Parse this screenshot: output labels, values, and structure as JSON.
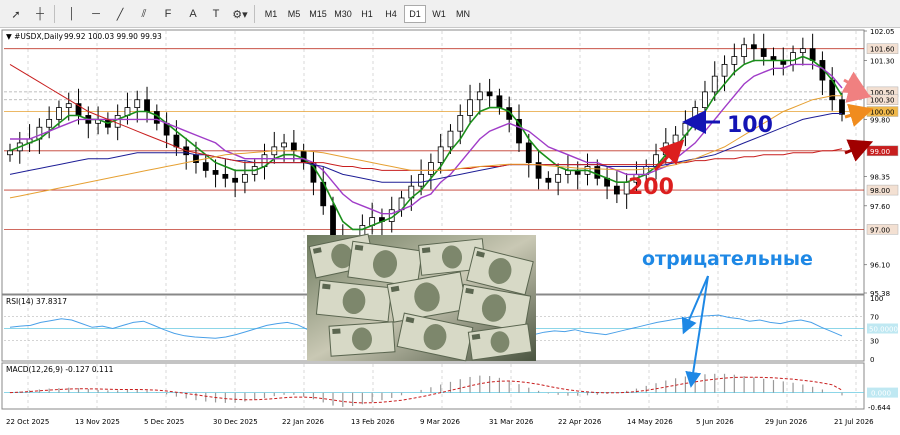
{
  "toolbar": {
    "tools": [
      "cursor-icon",
      "crosshair-icon",
      "vertical-line-icon",
      "horizontal-line-icon",
      "trendline-icon",
      "equidistant-channel-icon",
      "fibonacci-icon",
      "text-label-icon",
      "arrow-label-icon",
      "shapes-dropdown-icon"
    ],
    "timeframes": [
      "M1",
      "M5",
      "M15",
      "M30",
      "H1",
      "H4",
      "D1",
      "W1",
      "MN"
    ],
    "active_timeframe": "D1"
  },
  "chart_header": {
    "symbol": "▼ #USDX,Daily",
    "ohlc": "99.92 100.03 99.90 99.93"
  },
  "rsi_label": "RSI(14) 37.8317",
  "macd_label": "MACD(12,26,9) -0.127 0.111",
  "annotations": {
    "ma100": "100",
    "ma200": "200",
    "negative": "отрицательные"
  },
  "colors": {
    "ema_fast": "#1a8f1a",
    "ema_slow": "#a03cc8",
    "ma100": "#1e1e96",
    "ma200": "#c81e1e",
    "ma_long": "#e6a032",
    "level_red": "#c0392b",
    "level_gray": "#aaaaaa",
    "rsi": "#4aa0e8",
    "price_tag_bg": "#f3e0d2"
  },
  "chart_data": [
    {
      "type": "candlestick",
      "symbol": "#USDX",
      "timeframe": "Daily",
      "ylim": [
        95.38,
        102.05
      ],
      "y_ticks": [
        102.05,
        101.3,
        99.8,
        98.35,
        97.6,
        96.1,
        95.38
      ],
      "x_tick_labels": [
        "22 Oct 2025",
        "13 Nov 2025",
        "5 Dec 2025",
        "30 Dec 2025",
        "22 Jan 2026",
        "13 Feb 2026",
        "9 Mar 2026",
        "31 Mar 2026",
        "22 Apr 2026",
        "14 May 2026",
        "5 Jun 2026",
        "29 Jun 2026",
        "21 Jul 2026"
      ],
      "price_levels": [
        {
          "value": 101.6,
          "label": "101.60",
          "style": "solid",
          "color": "#c0392b"
        },
        {
          "value": 100.5,
          "label": "100.50",
          "style": "dashed",
          "color": "#aaaaaa"
        },
        {
          "value": 100.3,
          "label": "100.30",
          "style": "dashed",
          "color": "#aaaaaa"
        },
        {
          "value": 100.0,
          "label": "100.00",
          "style": "solid",
          "color": "#e6a032"
        },
        {
          "value": 99.0,
          "label": "99.00",
          "style": "solid",
          "color": "#c0392b"
        },
        {
          "value": 98.0,
          "label": "98.00",
          "style": "solid",
          "color": "#c0392b"
        },
        {
          "value": 97.0,
          "label": "97.00",
          "style": "solid",
          "color": "#c0392b"
        }
      ],
      "close": [
        99.0,
        99.2,
        99.3,
        99.6,
        99.8,
        100.1,
        100.2,
        99.9,
        99.7,
        99.8,
        99.6,
        99.9,
        100.1,
        100.3,
        100.0,
        99.7,
        99.4,
        99.1,
        98.9,
        98.7,
        98.5,
        98.4,
        98.3,
        98.2,
        98.4,
        98.6,
        98.9,
        99.1,
        99.2,
        99.0,
        98.7,
        98.2,
        97.6,
        96.8,
        96.2,
        96.6,
        97.1,
        97.3,
        97.2,
        97.5,
        97.8,
        98.1,
        98.4,
        98.7,
        99.1,
        99.5,
        99.9,
        100.3,
        100.5,
        100.4,
        100.1,
        99.8,
        99.2,
        98.7,
        98.3,
        98.2,
        98.4,
        98.5,
        98.4,
        98.6,
        98.3,
        98.1,
        97.9,
        98.2,
        98.4,
        98.6,
        98.9,
        99.2,
        99.4,
        99.7,
        100.1,
        100.5,
        100.9,
        101.2,
        101.4,
        101.7,
        101.6,
        101.4,
        101.3,
        101.2,
        101.5,
        101.6,
        101.3,
        100.8,
        100.3,
        99.93
      ],
      "series": [
        {
          "name": "EMA fast (green)",
          "values": [
            99.0,
            99.1,
            99.2,
            99.3,
            99.5,
            99.7,
            99.9,
            99.9,
            99.8,
            99.8,
            99.7,
            99.8,
            99.9,
            100.0,
            100.0,
            99.9,
            99.7,
            99.5,
            99.3,
            99.1,
            98.9,
            98.7,
            98.6,
            98.5,
            98.5,
            98.5,
            98.6,
            98.8,
            98.9,
            98.9,
            98.8,
            98.6,
            98.2,
            97.7,
            97.2,
            97.0,
            97.0,
            97.1,
            97.2,
            97.3,
            97.5,
            97.8,
            98.0,
            98.3,
            98.6,
            99.0,
            99.3,
            99.7,
            100.0,
            100.1,
            100.1,
            100.0,
            99.7,
            99.3,
            99.0,
            98.8,
            98.6,
            98.5,
            98.5,
            98.5,
            98.4,
            98.3,
            98.2,
            98.2,
            98.3,
            98.4,
            98.6,
            98.9,
            99.1,
            99.4,
            99.7,
            100.0,
            100.4,
            100.7,
            101.0,
            101.2,
            101.3,
            101.3,
            101.3,
            101.3,
            101.3,
            101.4,
            101.3,
            101.1,
            100.8,
            100.4
          ]
        },
        {
          "name": "EMA slow (purple)",
          "values": [
            99.3,
            99.3,
            99.3,
            99.4,
            99.5,
            99.6,
            99.7,
            99.8,
            99.8,
            99.8,
            99.8,
            99.8,
            99.8,
            99.8,
            99.8,
            99.8,
            99.7,
            99.6,
            99.5,
            99.4,
            99.3,
            99.2,
            99.0,
            98.9,
            98.8,
            98.8,
            98.8,
            98.8,
            98.8,
            98.8,
            98.8,
            98.7,
            98.5,
            98.2,
            97.9,
            97.7,
            97.6,
            97.5,
            97.4,
            97.4,
            97.5,
            97.6,
            97.8,
            97.9,
            98.2,
            98.4,
            98.7,
            99.0,
            99.3,
            99.5,
            99.6,
            99.7,
            99.6,
            99.5,
            99.3,
            99.1,
            99.0,
            98.9,
            98.8,
            98.7,
            98.7,
            98.6,
            98.5,
            98.4,
            98.4,
            98.4,
            98.5,
            98.6,
            98.8,
            99.0,
            99.2,
            99.5,
            99.8,
            100.1,
            100.4,
            100.7,
            100.9,
            101.0,
            101.1,
            101.1,
            101.2,
            101.2,
            101.2,
            101.1,
            100.9,
            100.6
          ]
        },
        {
          "name": "MA 100 (navy)",
          "values": [
            98.4,
            98.45,
            98.5,
            98.55,
            98.6,
            98.65,
            98.7,
            98.75,
            98.8,
            98.8,
            98.8,
            98.85,
            98.9,
            98.95,
            98.95,
            98.95,
            98.95,
            98.95,
            98.95,
            98.9,
            98.9,
            98.85,
            98.8,
            98.75,
            98.75,
            98.7,
            98.7,
            98.7,
            98.7,
            98.7,
            98.7,
            98.65,
            98.6,
            98.5,
            98.4,
            98.35,
            98.3,
            98.25,
            98.2,
            98.2,
            98.2,
            98.2,
            98.2,
            98.25,
            98.3,
            98.35,
            98.4,
            98.45,
            98.5,
            98.55,
            98.6,
            98.65,
            98.65,
            98.65,
            98.65,
            98.65,
            98.65,
            98.65,
            98.65,
            98.65,
            98.65,
            98.6,
            98.6,
            98.6,
            98.6,
            98.6,
            98.6,
            98.65,
            98.7,
            98.75,
            98.8,
            98.85,
            98.9,
            99.0,
            99.1,
            99.2,
            99.3,
            99.4,
            99.5,
            99.6,
            99.7,
            99.8,
            99.85,
            99.9,
            99.95,
            99.95
          ]
        },
        {
          "name": "MA 200 (red)",
          "values": [
            101.2,
            101.05,
            100.9,
            100.75,
            100.6,
            100.45,
            100.3,
            100.15,
            100.0,
            99.9,
            99.8,
            99.7,
            99.6,
            99.5,
            99.4,
            99.3,
            99.2,
            99.1,
            99.0,
            98.95,
            98.9,
            98.85,
            98.8,
            98.75,
            98.7,
            98.7,
            98.7,
            98.7,
            98.7,
            98.7,
            98.7,
            98.7,
            98.7,
            98.65,
            98.6,
            98.6,
            98.55,
            98.55,
            98.5,
            98.5,
            98.5,
            98.5,
            98.5,
            98.5,
            98.5,
            98.5,
            98.55,
            98.55,
            98.6,
            98.6,
            98.6,
            98.65,
            98.65,
            98.65,
            98.65,
            98.65,
            98.65,
            98.65,
            98.65,
            98.65,
            98.65,
            98.65,
            98.65,
            98.65,
            98.65,
            98.65,
            98.65,
            98.7,
            98.7,
            98.7,
            98.75,
            98.75,
            98.8,
            98.8,
            98.8,
            98.85,
            98.85,
            98.9,
            98.9,
            98.9,
            98.95,
            98.95,
            98.95,
            99.0,
            99.0,
            99.05
          ]
        },
        {
          "name": "MA long (orange)",
          "values": [
            97.8,
            97.85,
            97.9,
            97.95,
            98.0,
            98.05,
            98.1,
            98.15,
            98.2,
            98.25,
            98.3,
            98.35,
            98.4,
            98.45,
            98.5,
            98.55,
            98.6,
            98.65,
            98.7,
            98.75,
            98.8,
            98.85,
            98.9,
            98.92,
            98.94,
            98.96,
            98.98,
            99.0,
            99.0,
            99.0,
            99.0,
            98.98,
            98.95,
            98.9,
            98.85,
            98.8,
            98.75,
            98.7,
            98.65,
            98.6,
            98.55,
            98.5,
            98.5,
            98.5,
            98.5,
            98.52,
            98.55,
            98.58,
            98.6,
            98.62,
            98.64,
            98.66,
            98.66,
            98.66,
            98.64,
            98.62,
            98.6,
            98.58,
            98.56,
            98.55,
            98.54,
            98.53,
            98.52,
            98.52,
            98.52,
            98.54,
            98.56,
            98.6,
            98.65,
            98.72,
            98.8,
            98.9,
            99.0,
            99.1,
            99.25,
            99.4,
            99.55,
            99.7,
            99.85,
            100.0,
            100.1,
            100.2,
            100.3,
            100.35,
            100.4,
            100.4
          ]
        }
      ]
    },
    {
      "type": "line",
      "name": "RSI(14)",
      "ylim": [
        0,
        100
      ],
      "y_ticks": [
        100,
        70,
        50,
        30,
        0
      ],
      "levels": [
        70,
        50,
        30
      ],
      "values": [
        52,
        54,
        55,
        60,
        63,
        66,
        64,
        58,
        52,
        54,
        50,
        55,
        60,
        62,
        55,
        48,
        42,
        38,
        36,
        35,
        34,
        36,
        40,
        45,
        50,
        55,
        58,
        60,
        56,
        48,
        40,
        34,
        28,
        26,
        32,
        40,
        45,
        48,
        46,
        50,
        54,
        58,
        60,
        62,
        64,
        66,
        65,
        62,
        55,
        48,
        42,
        40,
        44,
        46,
        45,
        48,
        44,
        42,
        40,
        44,
        48,
        52,
        56,
        60,
        63,
        66,
        68,
        70,
        71,
        72,
        68,
        66,
        62,
        64,
        60,
        58,
        62,
        64,
        60,
        52,
        45,
        37.8317
      ]
    },
    {
      "type": "bar",
      "name": "MACD(12,26,9)",
      "ylim": [
        -0.644,
        1.1
      ],
      "y_ticks": [
        0.0,
        -0.644
      ],
      "values": [
        0.02,
        0.05,
        0.1,
        0.14,
        0.18,
        0.2,
        0.22,
        0.2,
        0.16,
        0.12,
        0.1,
        0.1,
        0.12,
        0.14,
        0.1,
        0.02,
        -0.08,
        -0.18,
        -0.26,
        -0.34,
        -0.4,
        -0.44,
        -0.46,
        -0.45,
        -0.4,
        -0.32,
        -0.24,
        -0.16,
        -0.1,
        -0.1,
        -0.18,
        -0.3,
        -0.44,
        -0.58,
        -0.64,
        -0.6,
        -0.52,
        -0.42,
        -0.34,
        -0.24,
        -0.12,
        0.0,
        0.12,
        0.24,
        0.36,
        0.48,
        0.6,
        0.7,
        0.76,
        0.74,
        0.66,
        0.54,
        0.38,
        0.22,
        0.08,
        -0.04,
        -0.1,
        -0.14,
        -0.14,
        -0.12,
        -0.1,
        -0.06,
        0.0,
        0.08,
        0.18,
        0.3,
        0.42,
        0.54,
        0.64,
        0.72,
        0.78,
        0.82,
        0.84,
        0.84,
        0.8,
        0.74,
        0.68,
        0.62,
        0.56,
        0.5,
        0.44,
        0.36,
        0.26,
        0.14,
        0.0,
        -0.127
      ],
      "signal": [
        0.0,
        0.02,
        0.05,
        0.08,
        0.11,
        0.14,
        0.16,
        0.17,
        0.17,
        0.16,
        0.15,
        0.14,
        0.14,
        0.14,
        0.13,
        0.11,
        0.07,
        0.02,
        -0.04,
        -0.1,
        -0.16,
        -0.22,
        -0.27,
        -0.3,
        -0.32,
        -0.32,
        -0.3,
        -0.27,
        -0.23,
        -0.2,
        -0.2,
        -0.22,
        -0.27,
        -0.33,
        -0.4,
        -0.44,
        -0.46,
        -0.45,
        -0.43,
        -0.39,
        -0.34,
        -0.27,
        -0.19,
        -0.1,
        0.0,
        0.1,
        0.2,
        0.3,
        0.4,
        0.47,
        0.51,
        0.52,
        0.49,
        0.44,
        0.37,
        0.28,
        0.2,
        0.13,
        0.07,
        0.03,
        0.0,
        -0.01,
        -0.01,
        0.01,
        0.05,
        0.1,
        0.17,
        0.25,
        0.33,
        0.41,
        0.48,
        0.55,
        0.6,
        0.65,
        0.68,
        0.69,
        0.69,
        0.68,
        0.66,
        0.63,
        0.6,
        0.55,
        0.5,
        0.43,
        0.35,
        0.111
      ]
    }
  ]
}
